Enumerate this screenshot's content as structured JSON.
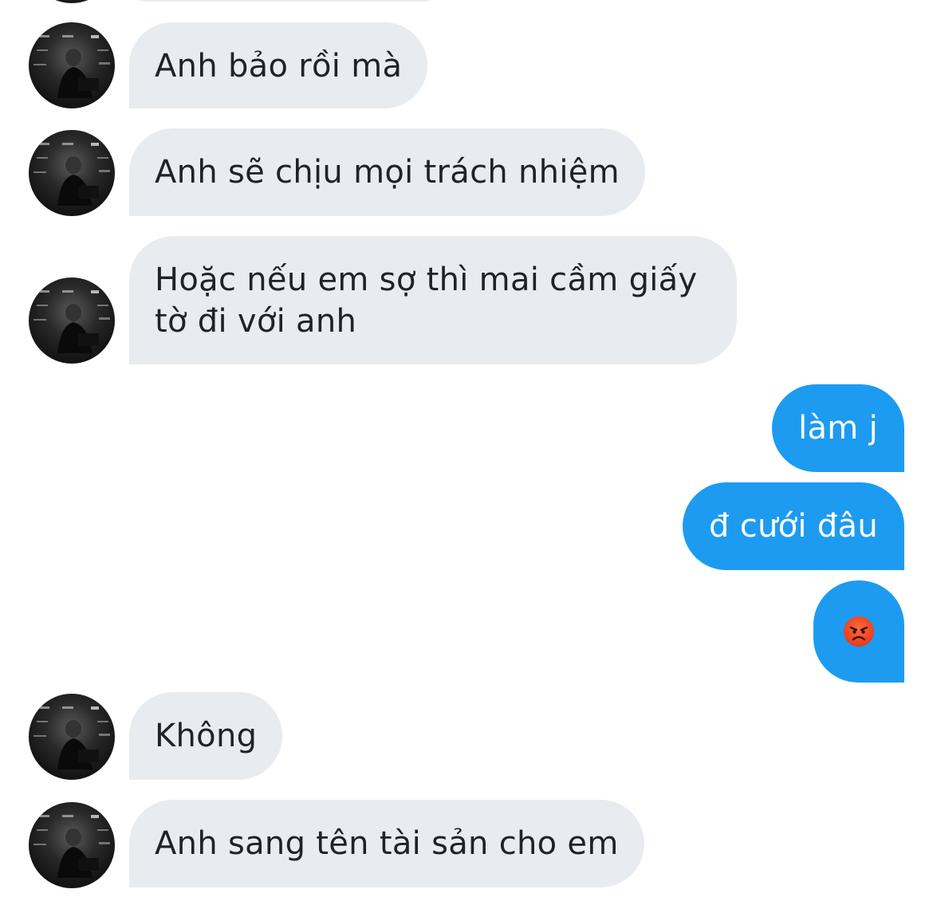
{
  "conversation": {
    "messages": [
      {
        "side": "in",
        "text": "Anh bảo rồi mà"
      },
      {
        "side": "in",
        "text": "Anh sẽ chịu mọi trách nhiệm"
      },
      {
        "side": "in",
        "text": "Hoặc nếu em sợ thì mai cầm giấy tờ đi với anh"
      },
      {
        "side": "out",
        "text": "làm j"
      },
      {
        "side": "out",
        "text": "đ cưới đâu"
      },
      {
        "side": "out",
        "icon": "angry-face-emoji"
      },
      {
        "side": "in",
        "text": "Không"
      },
      {
        "side": "in",
        "text": "Anh sang tên tài sản cho em"
      }
    ]
  },
  "colors": {
    "incoming_bubble": "#e8ecf0",
    "outgoing_bubble": "#1d9bf0",
    "incoming_text": "#1f2328",
    "outgoing_text": "#ffffff"
  },
  "avatar": {
    "icon": "contact-avatar-photo"
  }
}
